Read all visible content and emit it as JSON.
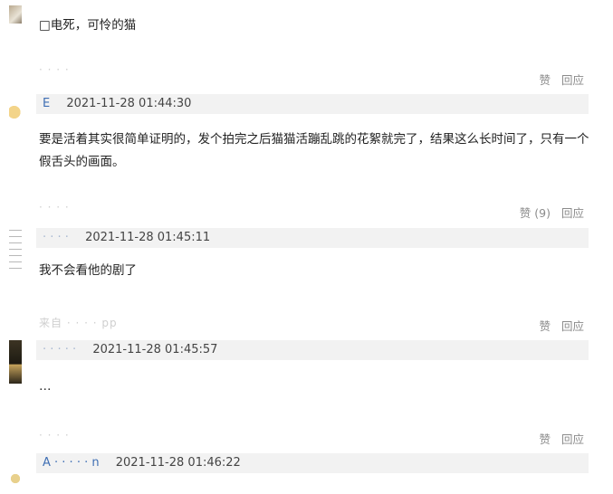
{
  "comments": [
    {
      "text": "□电死，可怜的猫",
      "source": "· · · ·",
      "like_label": "赞",
      "reply_label": "回应",
      "username": "E",
      "time": "2021-11-28 01:44:30"
    },
    {
      "text": "要是活着其实很简单证明的，发个拍完之后猫猫活蹦乱跳的花絮就完了，结果这么长时间了，只有一个假舌头的画面。",
      "source": "· · · ·",
      "like_label": "赞 (9)",
      "reply_label": "回应",
      "username": "· · · ·",
      "time": "2021-11-28 01:45:11"
    },
    {
      "text": "我不会看他的剧了",
      "source": "来自 · · · · pp",
      "like_label": "赞",
      "reply_label": "回应",
      "username": "· · · · ·",
      "time": "2021-11-28 01:45:57"
    },
    {
      "text": "…",
      "source": "· · · ·",
      "like_label": "赞",
      "reply_label": "回应",
      "username": "A · · · · · n",
      "time": "2021-11-28 01:46:22"
    }
  ]
}
